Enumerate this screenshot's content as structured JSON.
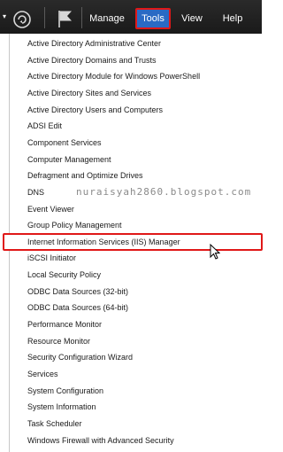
{
  "toolbar": {
    "dropdown_arrow": "▾",
    "refresh_icon": "refresh-icon",
    "flag_icon": "notifications-flag-icon",
    "menus": [
      {
        "label": "Manage",
        "active": false
      },
      {
        "label": "Tools",
        "active": true
      },
      {
        "label": "View",
        "active": false
      },
      {
        "label": "Help",
        "active": false
      }
    ]
  },
  "tools_menu": {
    "items": [
      "Active Directory Administrative Center",
      "Active Directory Domains and Trusts",
      "Active Directory Module for Windows PowerShell",
      "Active Directory Sites and Services",
      "Active Directory Users and Computers",
      "ADSI Edit",
      "Component Services",
      "Computer Management",
      "Defragment and Optimize Drives",
      "DNS",
      "Event Viewer",
      "Group Policy Management",
      "Internet Information Services (IIS) Manager",
      "iSCSI Initiator",
      "Local Security Policy",
      "ODBC Data Sources (32-bit)",
      "ODBC Data Sources (64-bit)",
      "Performance Monitor",
      "Resource Monitor",
      "Security Configuration Wizard",
      "Services",
      "System Configuration",
      "System Information",
      "Task Scheduler",
      "Windows Firewall with Advanced Security"
    ],
    "highlighted_item": "Internet Information Services (IIS) Manager"
  },
  "watermark": "nuraisyah2860.blogspot.com",
  "colors": {
    "toolbar_bg": "#1e1e1e",
    "tools_active_bg": "#2a6ac4",
    "highlight_border": "#e01818",
    "menu_text": "#1a1a1a"
  }
}
